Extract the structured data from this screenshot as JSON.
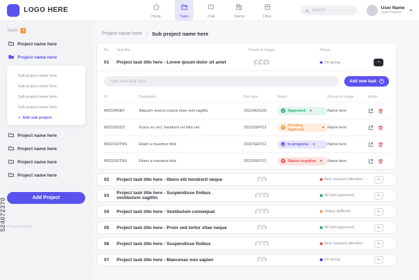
{
  "colors": {
    "accent": "#5a52ee",
    "approved": "#1fae6f",
    "pending": "#f2994a",
    "in_progress": "#5a52ee",
    "negative": "#eb4d4d",
    "ongoing_dot": "#4338e6",
    "badge": "#f2994a"
  },
  "watermark": {
    "id_text": "524072370"
  },
  "header": {
    "logo_text": "LOGO HERE",
    "nav": [
      {
        "label": "Home"
      },
      {
        "label": "Tasks"
      },
      {
        "label": "Chat"
      },
      {
        "label": "Clients"
      },
      {
        "label": "Drive"
      }
    ],
    "search_placeholder": "Search",
    "user_name": "User Name",
    "user_position": "User Position"
  },
  "sidebar": {
    "section_label": "Tasks",
    "badge": "+",
    "projects_top": [
      "Project name here"
    ],
    "active_project": "Project name here",
    "subprojects": [
      "Sub project name here",
      "Sub project name here",
      "Sub project name here",
      "Sub project name here"
    ],
    "add_subproject_label": "Add sub project",
    "projects_bottom": [
      "Project name here",
      "Project name here",
      "Project name here",
      "Project name here"
    ],
    "add_project_label": "Add Project",
    "footer_link": "Project setting"
  },
  "main": {
    "breadcrumb": {
      "parent": "Project name here",
      "separator": "›",
      "current": "Sub project name here"
    },
    "columns": {
      "no": "No.",
      "title": "Task title",
      "person": "Person in charge",
      "status": "Status"
    },
    "open_task": {
      "no": "01",
      "title": "Project task title here - Lorem ipsum dolor sit amet",
      "status": "On going",
      "collapse": "−"
    },
    "new_task": {
      "placeholder": "Type new task here",
      "button_label": "Add new task",
      "plus": "+"
    },
    "subtable": {
      "columns": {
        "id": "ID",
        "description": "Description",
        "due": "Due date",
        "status": "Status",
        "person": "Person in charge",
        "action": "Action"
      },
      "chevron": "▾",
      "rows": [
        {
          "id": "MDO34SEF",
          "description": "Aliquam viverra massa vitae velit sagittis",
          "due": "2022/AUG/31",
          "status": "Approved",
          "person": "Name here"
        },
        {
          "id": "MDO26SDC",
          "description": "Fusce ex orci, hendrerit vel felis nec",
          "due": "2022/SEP/12",
          "status": "Pending Approval",
          "person": "Name here"
        },
        {
          "id": "MDO192TNS",
          "description": "Etiam a maximus felis",
          "due": "2022/SEP/12",
          "status": "In progress",
          "person": "Name here"
        },
        {
          "id": "MDO192TNS",
          "description": "Etiam a maximus felis",
          "due": "2022/SEP/12",
          "status": "Status negative",
          "person": "Name here"
        }
      ]
    },
    "tasks": [
      {
        "no": "02",
        "title": "Project task title here - libero elit hendrerit neque",
        "status": "Item required attention",
        "expand": "+"
      },
      {
        "no": "03",
        "title": "Project task title here - Suspendisse finibus vestibulum sagittis",
        "status": "All item approved",
        "expand": "+"
      },
      {
        "no": "04",
        "title": "Project task title here - Vestibulum consequat",
        "status": "Status deffered",
        "expand": "+"
      },
      {
        "no": "05",
        "title": "Project task title here - Proin sed tortor vitae neque",
        "status": "All item approved",
        "expand": "+"
      },
      {
        "no": "06",
        "title": "Project task title here - Suspendisse finibus",
        "status": "Item required attention",
        "expand": "+"
      },
      {
        "no": "07",
        "title": "Project task title here - Maecenas non sapien",
        "status": "On going",
        "expand": "+"
      }
    ]
  }
}
